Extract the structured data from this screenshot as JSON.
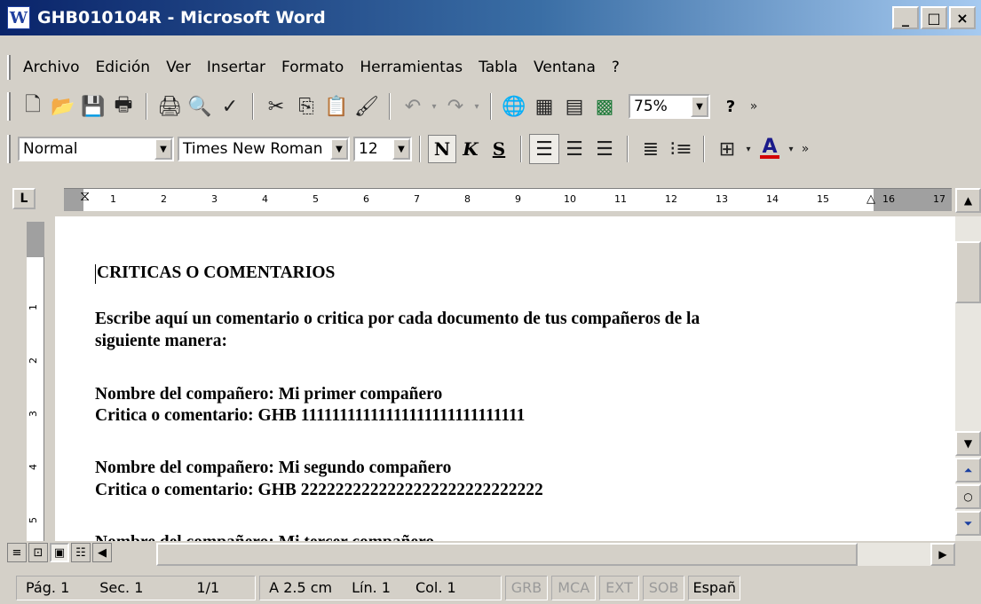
{
  "window": {
    "title": "GHB010104R - Microsoft Word",
    "app_icon": "word-doc-icon",
    "controls": [
      "minimize-icon",
      "maximize-icon",
      "close-icon"
    ]
  },
  "menu": {
    "items": [
      "Archivo",
      "Edición",
      "Ver",
      "Insertar",
      "Formato",
      "Herramientas",
      "Tabla",
      "Ventana",
      "?"
    ]
  },
  "toolbar_standard": {
    "zoom": "75%",
    "buttons": [
      "new-doc-icon",
      "open-folder-icon",
      "save-icon",
      "permission-icon",
      "print-icon",
      "print-preview-icon",
      "spelling-icon",
      "cut-icon",
      "copy-icon",
      "paste-icon",
      "format-painter-icon",
      "undo-icon",
      "redo-icon",
      "hyperlink-icon",
      "tables-borders-icon",
      "insert-table-icon",
      "insert-excel-icon",
      "help-icon"
    ]
  },
  "toolbar_format": {
    "style": "Normal",
    "font": "Times New Roman",
    "size": "12",
    "bold_label": "N",
    "italic_label": "K",
    "underline_label": "S",
    "font_color": "#d40000"
  },
  "ruler": {
    "numbers": [
      "1",
      "2",
      "3",
      "4",
      "5",
      "6",
      "7",
      "8",
      "9",
      "10",
      "11",
      "12",
      "13",
      "14",
      "15",
      "16",
      "17"
    ],
    "vertical_numbers": [
      "1",
      "2",
      "3",
      "4",
      "5"
    ]
  },
  "document": {
    "heading": "CRITICAS O COMENTARIOS",
    "intro_line1": "Escribe aquí un comentario o critica por cada documento de tus compañeros de la",
    "intro_line2": "siguiente manera:",
    "entries": [
      {
        "name": "Nombre del compañero: Mi primer compañero",
        "comment": "Critica o comentario: GHB 11111111111111111111111111111"
      },
      {
        "name": "Nombre del compañero: Mi segundo compañero",
        "comment": "Critica o comentario: GHB 2222222222222222222222222222"
      },
      {
        "name": "Nombre del compañero: Mi tercer compañero",
        "comment": ""
      }
    ]
  },
  "status": {
    "page": "Pág. 1",
    "section": "Sec. 1",
    "pages": "1/1",
    "at": "A 2.5 cm",
    "line": "Lín. 1",
    "col": "Col. 1",
    "grb": "GRB",
    "mca": "MCA",
    "ext": "EXT",
    "sob": "SOB",
    "lang": "Españ"
  }
}
